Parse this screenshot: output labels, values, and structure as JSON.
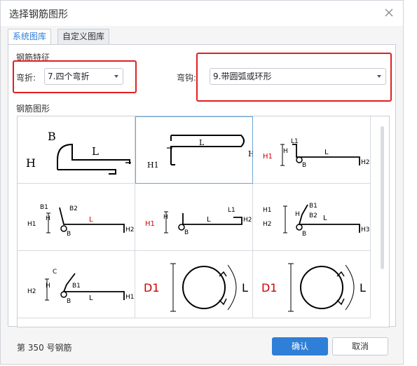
{
  "window": {
    "title": "选择钢筋图形"
  },
  "tabs": [
    {
      "label": "系统图库",
      "active": true
    },
    {
      "label": "自定义图库",
      "active": false
    }
  ],
  "features": {
    "title": "钢筋特征",
    "bend": {
      "label": "弯折:",
      "value": "7.四个弯折"
    },
    "hook": {
      "label": "弯钩:",
      "value": "9.带圆弧或环形"
    }
  },
  "gallery": {
    "title": "钢筋图形",
    "cells": [
      {
        "labels": [
          "B",
          "H",
          "L"
        ]
      },
      {
        "labels": [
          "L",
          "H1",
          "H"
        ]
      },
      {
        "labels": [
          "L1",
          "H",
          "H1",
          "L",
          "B",
          "H2"
        ]
      },
      {
        "labels": [
          "B1",
          "B2",
          "H1",
          "H",
          "B",
          "L",
          "H2"
        ]
      },
      {
        "labels": [
          "H",
          "H1",
          "L1",
          "B",
          "L",
          "H2"
        ]
      },
      {
        "labels": [
          "B1",
          "B2",
          "H1",
          "H",
          "H2",
          "B",
          "L",
          "H3"
        ]
      },
      {
        "labels": [
          "C",
          "H2",
          "H",
          "B1",
          "B",
          "L",
          "H1"
        ]
      },
      {
        "labels": [
          "D1",
          "L"
        ]
      },
      {
        "labels": [
          "D1",
          "L"
        ]
      }
    ]
  },
  "footer": {
    "status": "第 350 号钢筋",
    "ok": "确认",
    "cancel": "取消"
  },
  "colors": {
    "accent": "#2f7fd8",
    "highlight": "#e02020",
    "label_red": "#cc0000"
  }
}
